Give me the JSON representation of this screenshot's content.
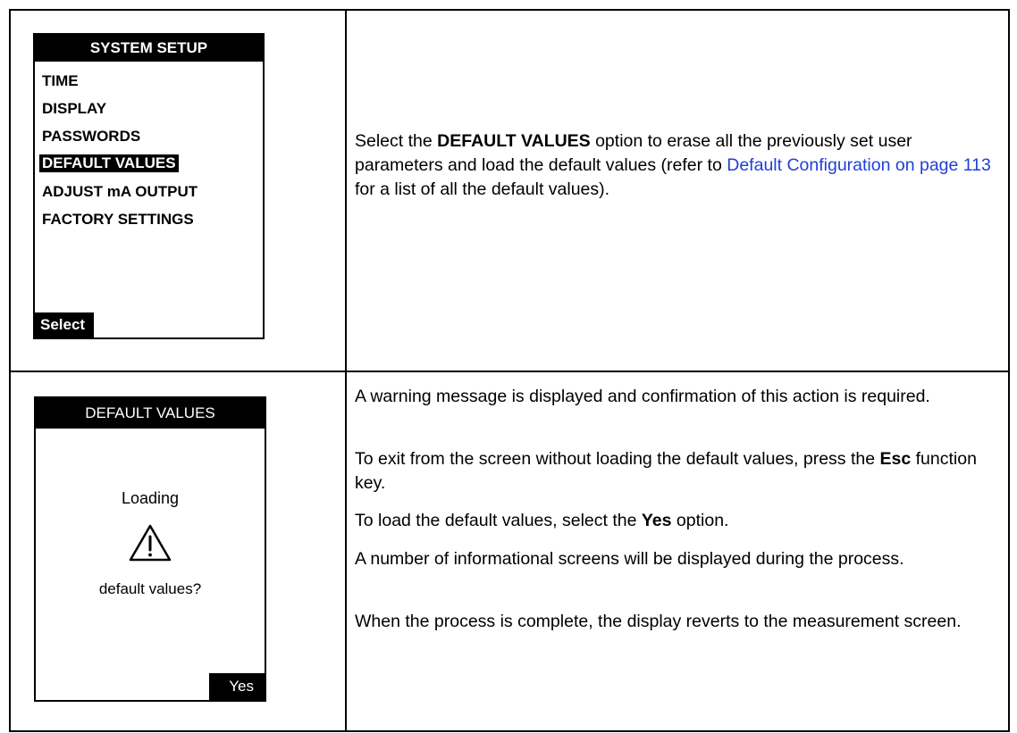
{
  "screens": {
    "system_setup": {
      "title": "SYSTEM SETUP",
      "menu": [
        {
          "label": "TIME"
        },
        {
          "label": "DISPLAY"
        },
        {
          "label": "PASSWORDS"
        },
        {
          "label": "DEFAULT VALUES"
        },
        {
          "label": "ADJUST mA OUTPUT"
        },
        {
          "label": "FACTORY SETTINGS"
        }
      ],
      "selected_index": 3,
      "softkey_left": "Select"
    },
    "default_values": {
      "title": "DEFAULT VALUES",
      "message_top": "Loading",
      "icon": "warning-icon",
      "message_bottom": "default values?",
      "softkey_right": "Yes"
    }
  },
  "instructions": {
    "row1": {
      "p1_pre": "Select the ",
      "p1_bold": "DEFAULT VALUES",
      "p1_mid": " option to erase all the previously set user parameters and load the default values (refer to ",
      "p1_link": "Default Configuration on page 113",
      "p1_post": " for a list of all the default values)."
    },
    "row2": {
      "p1": "A warning message is displayed and confirmation of this action is required.",
      "p2_pre": "To exit from the screen without loading the default values, press the ",
      "p2_bold": "Esc",
      "p2_post": " function key.",
      "p3_pre": "To load the default values, select the ",
      "p3_bold": "Yes",
      "p3_post": " option.",
      "p4": "A number of informational screens will be displayed during the process.",
      "p5": "When the process is complete, the display reverts to the measurement screen."
    }
  },
  "colors": {
    "link": "#1f3fd6",
    "screen_bg": "#ffffff",
    "screen_fg": "#000000"
  }
}
